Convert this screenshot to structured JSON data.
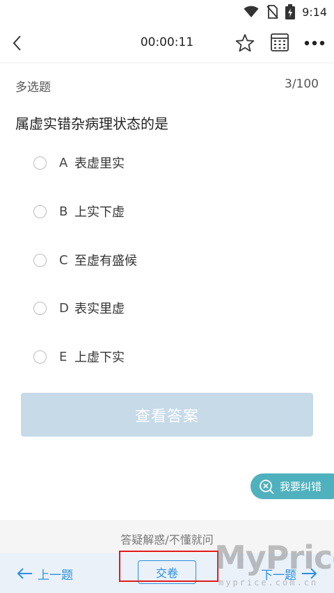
{
  "status_bar": {
    "time": "9:14",
    "icons": [
      "wifi-icon",
      "no-sim-icon",
      "battery-charging-icon"
    ]
  },
  "toolbar": {
    "back_icon": "chevron-left-icon",
    "timer": "00:00:11",
    "icons": [
      "star-icon",
      "answer-sheet-icon",
      "more-icon"
    ]
  },
  "question": {
    "type": "多选题",
    "progress": "3/100",
    "stem": "属虚实错杂病理状态的是",
    "options": [
      {
        "letter": "A",
        "text": "表虚里实"
      },
      {
        "letter": "B",
        "text": "上实下虚"
      },
      {
        "letter": "C",
        "text": "至虚有盛候"
      },
      {
        "letter": "D",
        "text": "表实里虚"
      },
      {
        "letter": "E",
        "text": "上虚下实"
      }
    ]
  },
  "answer_button": "查看答案",
  "report_button": "我要纠错",
  "ask_bar": "答疑解惑/不懂就问",
  "bottom_nav": {
    "prev": "上一题",
    "submit": "交卷",
    "next": "下一题"
  },
  "watermark": {
    "big": "MyPrice",
    "small": "myprice.com.cn"
  },
  "colors": {
    "accent": "#2b8fe0",
    "answer_button_bg": "#c6dae8",
    "report_button_bg": "#4fb1bd",
    "highlight": "#e01b1b"
  }
}
